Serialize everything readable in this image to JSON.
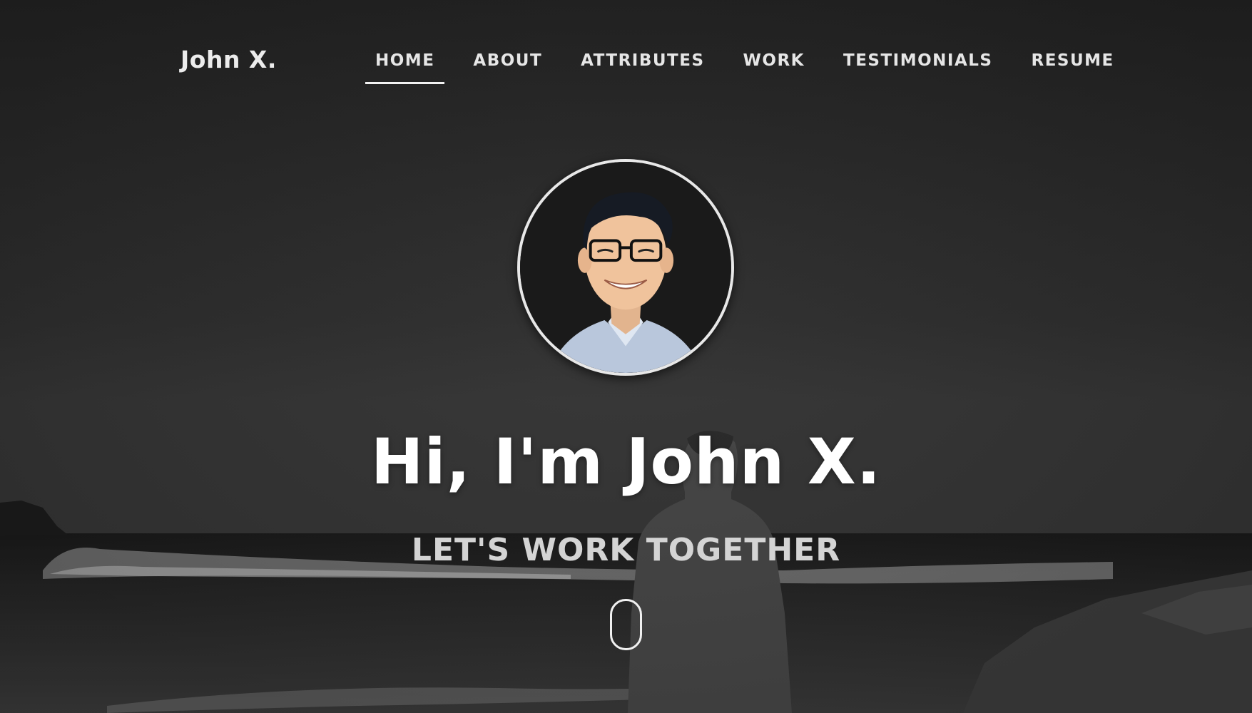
{
  "nav": {
    "logo": "John X.",
    "items": [
      {
        "label": "HOME",
        "active": true
      },
      {
        "label": "ABOUT",
        "active": false
      },
      {
        "label": "ATTRIBUTES",
        "active": false
      },
      {
        "label": "WORK",
        "active": false
      },
      {
        "label": "TESTIMONIALS",
        "active": false
      },
      {
        "label": "RESUME",
        "active": false
      }
    ]
  },
  "hero": {
    "headline": "Hi, I'm John X.",
    "subheadline": "LET'S WORK TOGETHER",
    "avatar_icon": "profile-photo",
    "scroll_icon": "mouse-scroll-icon"
  },
  "colors": {
    "text_primary": "#ffffff",
    "text_secondary": "#d4d4d4",
    "background": "#2b2b2b"
  }
}
